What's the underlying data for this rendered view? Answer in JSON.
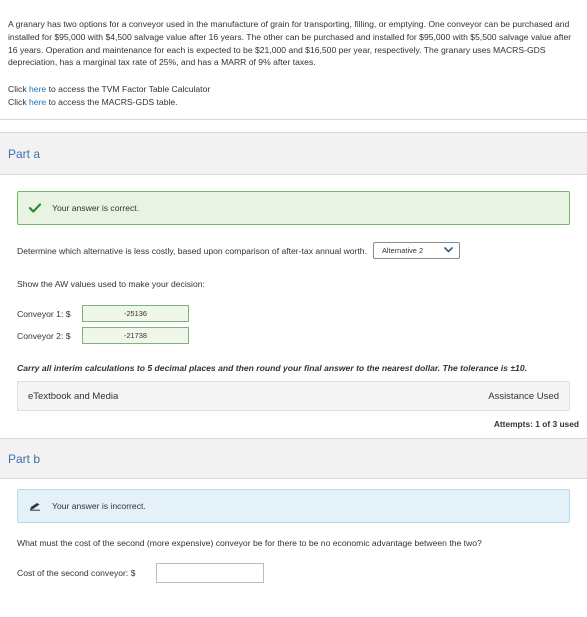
{
  "problem": {
    "text": "A granary has two options for a conveyor used in the manufacture of grain for transporting, filling, or emptying. One conveyor can be purchased and installed for $95,000 with $4,500 salvage value after 16 years. The other can be purchased and installed for $95,000 with $5,500 salvage value after 16 years. Operation and maintenance for each is expected to be $21,000 and $16,500 per year, respectively. The granary uses MACRS-GDS depreciation, has a marginal tax rate of 25%, and has a MARR of 9% after taxes."
  },
  "links": [
    {
      "prefix": "Click ",
      "link": "here",
      "suffix": " to access the TVM Factor Table Calculator"
    },
    {
      "prefix": "Click ",
      "link": "here",
      "suffix": " to access the MACRS-GDS table."
    }
  ],
  "part_a": {
    "title": "Part a",
    "status": "Your answer is correct.",
    "question": "Determine which alternative is less costly, based upon comparison of after-tax annual worth.",
    "selected_option": "Alternative 2",
    "aw_prompt": "Show the AW values used to make your decision:",
    "conveyor1_label": "Conveyor 1: $",
    "conveyor1_value": "-25136",
    "conveyor2_label": "Conveyor 2: $",
    "conveyor2_value": "-21738",
    "note": "Carry all interim calculations to 5 decimal places and then round your final answer to the nearest dollar. The tolerance is ±10.",
    "etextbook": "eTextbook and Media",
    "assistance": "Assistance Used",
    "attempts": "Attempts: 1 of 3 used"
  },
  "part_b": {
    "title": "Part b",
    "status": "Your answer is incorrect.",
    "question": "What must the cost of the second (more expensive) conveyor be for there to be no economic advantage between the two?",
    "cost_label": "Cost of the second conveyor: $",
    "cost_value": ""
  },
  "colors": {
    "link": "#1a73b5",
    "part_title": "#3a74ab",
    "correct_border": "#7ab46a",
    "correct_bg": "#e8f3e3",
    "incorrect_bg": "#e4f1f8",
    "check": "#2e8b2e"
  },
  "icons": {
    "correct": "check-icon",
    "incorrect": "pencil-icon",
    "dropdown": "chevron-down-icon"
  }
}
